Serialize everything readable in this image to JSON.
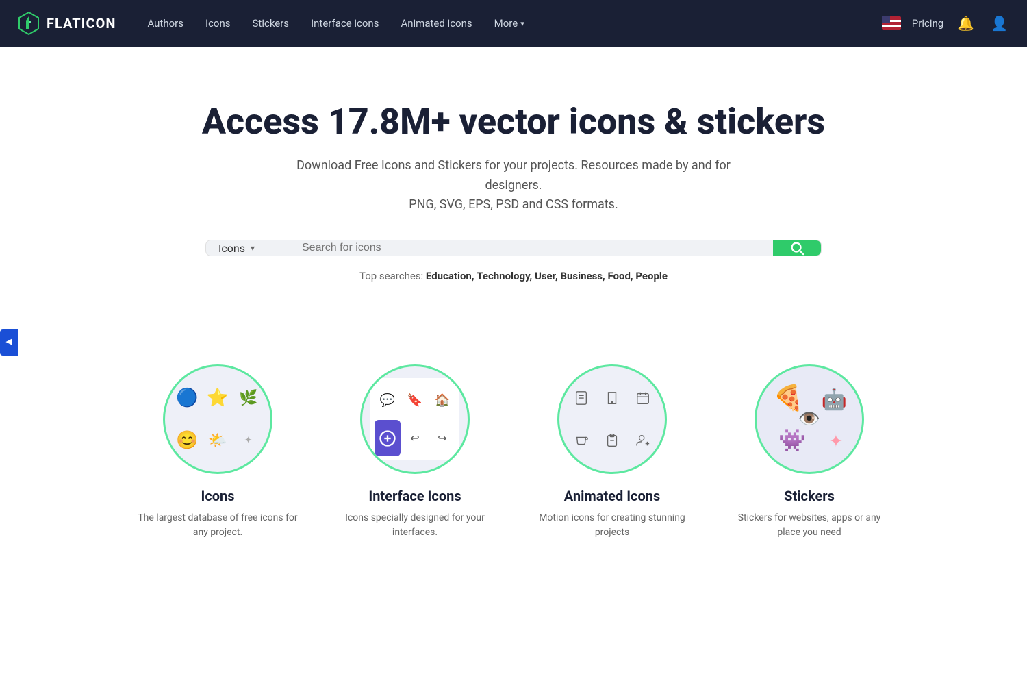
{
  "navbar": {
    "logo_text": "FLATICON",
    "nav_items": [
      {
        "label": "Authors",
        "id": "authors"
      },
      {
        "label": "Icons",
        "id": "icons"
      },
      {
        "label": "Stickers",
        "id": "stickers"
      },
      {
        "label": "Interface icons",
        "id": "interface-icons"
      },
      {
        "label": "Animated icons",
        "id": "animated-icons"
      },
      {
        "label": "More",
        "id": "more",
        "has_arrow": true
      }
    ],
    "pricing_label": "Pricing",
    "lang": "EN"
  },
  "hero": {
    "title": "Access 17.8M+ vector icons & stickers",
    "subtitle_line1": "Download Free Icons and Stickers for your projects. Resources made by and for designers.",
    "subtitle_line2": "PNG, SVG, EPS, PSD and CSS formats.",
    "search_placeholder": "Search for icons",
    "search_type": "Icons",
    "search_button_icon": "🔍"
  },
  "top_searches": {
    "label": "Top searches:",
    "items": [
      "Education",
      "Technology",
      "User",
      "Business",
      "Food",
      "People"
    ]
  },
  "categories": [
    {
      "id": "icons",
      "title": "Icons",
      "description": "The largest database of free icons for any project."
    },
    {
      "id": "interface-icons",
      "title": "Interface Icons",
      "description": "Icons specially designed for your interfaces."
    },
    {
      "id": "animated-icons",
      "title": "Animated Icons",
      "description": "Motion icons for creating stunning projects"
    },
    {
      "id": "stickers",
      "title": "Stickers",
      "description": "Stickers for websites, apps or any place you need"
    }
  ],
  "sidebar": {
    "tab_label": "▶"
  }
}
